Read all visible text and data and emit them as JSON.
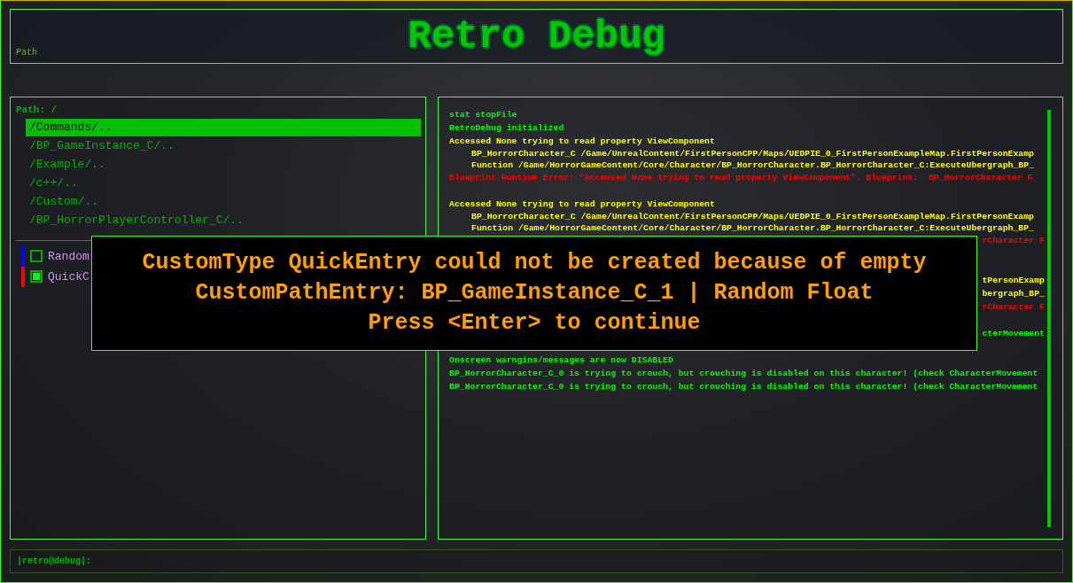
{
  "header": {
    "title": "Retro Debug",
    "path_label": "Path"
  },
  "browser": {
    "path": "Path: /",
    "items": [
      {
        "label": "/Commands/..",
        "selected": true
      },
      {
        "label": "/BP_GameInstance_C/..",
        "selected": false
      },
      {
        "label": "/Example/..",
        "selected": false
      },
      {
        "label": "/c++/..",
        "selected": false
      },
      {
        "label": "/Custom/..",
        "selected": false
      },
      {
        "label": "/BP_HorrorPlayerController_C/..",
        "selected": false
      }
    ],
    "entries": [
      {
        "label": "Random",
        "color": "#0000ff",
        "checked": false
      },
      {
        "label": "QuickC",
        "color": "#ff0000",
        "checked": true
      }
    ]
  },
  "log": [
    {
      "kind": "line",
      "text": "stat stopFile",
      "color": "#00ff00"
    },
    {
      "kind": "line",
      "text": "RetroDebug initialized",
      "color": "#00ff00"
    },
    {
      "kind": "line",
      "text": "Accessed None trying to read property ViewComponent",
      "color": "#ffff00"
    },
    {
      "kind": "detail",
      "text": "BP_HorrorCharacter_C /Game/UnrealContent/FirstPersonCPP/Maps/UEDPIE_0_FirstPersonExampleMap.FirstPersonExamp",
      "color": "#ffff00"
    },
    {
      "kind": "detail",
      "text": "Function /Game/HorrorGameContent/Core/Character/BP_HorrorCharacter.BP_HorrorCharacter_C:ExecuteUbergraph_BP_",
      "color": "#ffff00"
    },
    {
      "kind": "line",
      "text": "Blueprint Runtime Error: \"Accessed None trying to read property ViewComponent\". Blueprint:  BP_HorrorCharacter F",
      "color": "#ff0000"
    },
    {
      "kind": "spacer"
    },
    {
      "kind": "line",
      "text": "Accessed None trying to read property ViewComponent",
      "color": "#ffff00"
    },
    {
      "kind": "detail",
      "text": "BP_HorrorCharacter_C /Game/UnrealContent/FirstPersonCPP/Maps/UEDPIE_0_FirstPersonExampleMap.FirstPersonExamp",
      "color": "#ffff00"
    },
    {
      "kind": "detail",
      "text": "Function /Game/HorrorGameContent/Core/Character/BP_HorrorCharacter.BP_HorrorCharacter_C:ExecuteUbergraph_BP_",
      "color": "#ffff00"
    },
    {
      "kind": "fragment",
      "text": "rCharacter F",
      "color": "#ff0000"
    },
    {
      "kind": "spacer"
    },
    {
      "kind": "spacer"
    },
    {
      "kind": "fragment",
      "text": "tPersonExamp",
      "color": "#ffff00"
    },
    {
      "kind": "fragment",
      "text": "bergraph_BP_",
      "color": "#ffff00"
    },
    {
      "kind": "fragment",
      "text": "rCharacter F",
      "color": "#ff0000"
    },
    {
      "kind": "spacer"
    },
    {
      "kind": "fragment",
      "text": "cterMovement",
      "color": "#00ff00"
    },
    {
      "kind": "spacer"
    },
    {
      "kind": "line",
      "text": "Onscreen warngins/messages are now DISABLED",
      "color": "#00ff00"
    },
    {
      "kind": "line",
      "text": "BP_HorrorCharacter_C_0 is trying to crouch, but crouching is disabled on this character! (check CharacterMovement",
      "color": "#00ff00"
    },
    {
      "kind": "line",
      "text": "BP_HorrorCharacter_C_0 is trying to crouch, but crouching is disabled on this character! (check CharacterMovement",
      "color": "#00ff00"
    }
  ],
  "console": {
    "prompt": "|retro@debug|:"
  },
  "dialog": {
    "lines": [
      "CustomType QuickEntry could not be created because of empty",
      "CustomPathEntry: BP_GameInstance_C_1 | Random Float",
      "Press <Enter> to continue"
    ]
  }
}
